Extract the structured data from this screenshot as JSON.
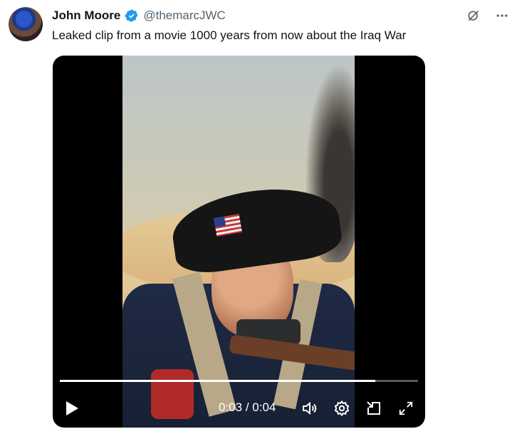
{
  "tweet": {
    "author_name": "John Moore",
    "handle": "@themarcJWC",
    "text": "Leaked clip from a movie 1000 years from now about the Iraq War"
  },
  "icons": {
    "verified": "verified-badge-icon",
    "grok": "grok-icon",
    "more": "more-icon",
    "play": "play-icon",
    "volume": "volume-icon",
    "settings": "settings-icon",
    "pip": "picture-in-picture-icon",
    "fullscreen": "fullscreen-icon"
  },
  "video": {
    "current_time": "0:03",
    "separator": " / ",
    "duration": "0:04",
    "progress": 0.88
  },
  "colors": {
    "verified_blue": "#1d9bf0",
    "secondary_text": "#536471",
    "primary_text": "#0f1419"
  }
}
